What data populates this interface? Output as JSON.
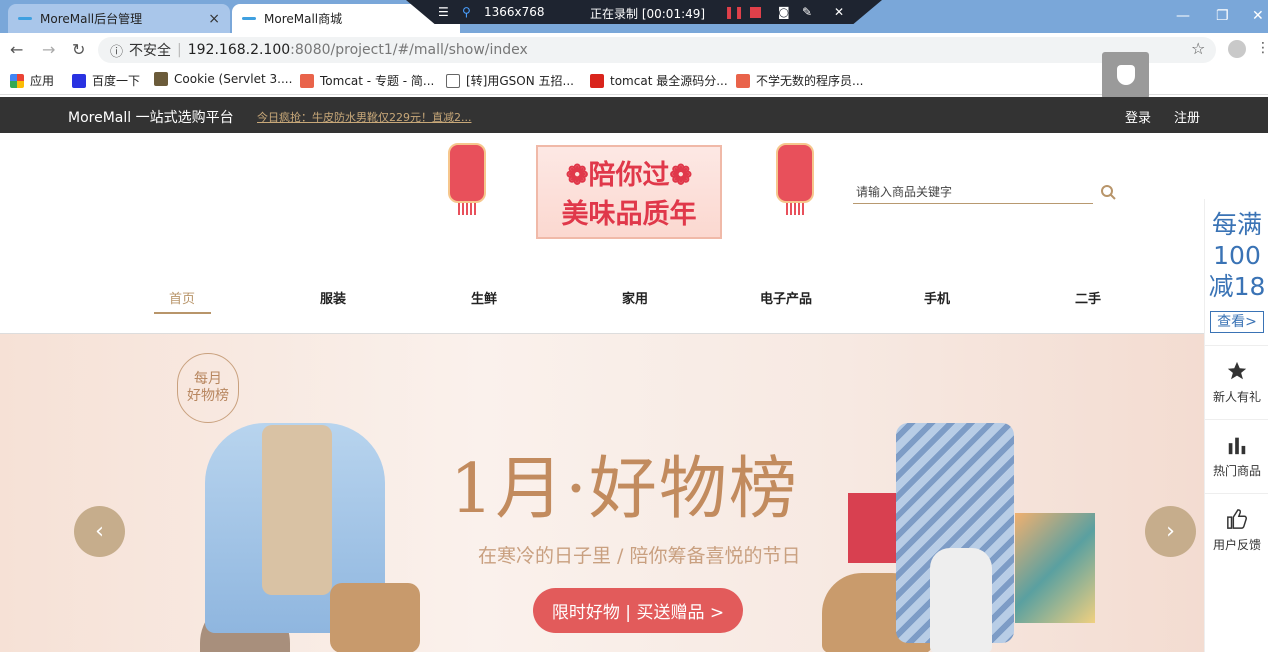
{
  "browser": {
    "tabs": [
      {
        "label": "MoreMall后台管理",
        "close": "×"
      },
      {
        "label": "MoreMall商城"
      }
    ],
    "recorder": {
      "resolution": "1366x768",
      "status": "正在录制 [00:01:49]"
    },
    "window_controls": {
      "minimize": "—",
      "maximize": "❐",
      "close": "✕"
    },
    "url": {
      "security": "不安全",
      "host": "192.168.2.100",
      "path": ":8080/project1/#/mall/show/index"
    },
    "bookmarks": [
      {
        "label": "应用",
        "color": "#4285f4"
      },
      {
        "label": "百度一下",
        "color": "#2932e1"
      },
      {
        "label": "Cookie (Servlet 3....",
        "color": "#6b5b3a"
      },
      {
        "label": "Tomcat - 专题 - 简...",
        "color": "#e9634a"
      },
      {
        "label": "[转]用GSON 五招...",
        "color": "#666666"
      },
      {
        "label": "tomcat 最全源码分...",
        "color": "#d9241c"
      },
      {
        "label": "不学无数的程序员...",
        "color": "#e9634a"
      }
    ]
  },
  "site": {
    "brand": "MoreMall 一站式选购平台",
    "promo": "今日疯抢：牛皮防水男靴仅229元！直减2...",
    "login": "登录",
    "register": "注册",
    "logo_line1": "❁陪你过❁",
    "logo_line2": "美味品质年",
    "search_placeholder": "请输入商品关键字",
    "categories": [
      {
        "label": "首页",
        "active": true
      },
      {
        "label": "服装"
      },
      {
        "label": "生鲜"
      },
      {
        "label": "家用"
      },
      {
        "label": "电子产品"
      },
      {
        "label": "手机"
      },
      {
        "label": "二手"
      }
    ],
    "hero": {
      "badge": "每月\n好物榜",
      "title": "1月·好物榜",
      "subtitle": "在寒冷的日子里 / 陪你筹备喜悦的节日",
      "button": "限时好物 | 买送赠品 >",
      "prev": "‹",
      "next": "›"
    },
    "side": {
      "promo_line1": "每满",
      "promo_line2": "100",
      "promo_line3": "减18",
      "promo_look": "查看>",
      "items": [
        {
          "label": "新人有礼",
          "icon": "star-icon"
        },
        {
          "label": "热门商品",
          "icon": "bar-chart-icon"
        },
        {
          "label": "用户反馈",
          "icon": "thumbs-up-icon"
        }
      ]
    }
  }
}
